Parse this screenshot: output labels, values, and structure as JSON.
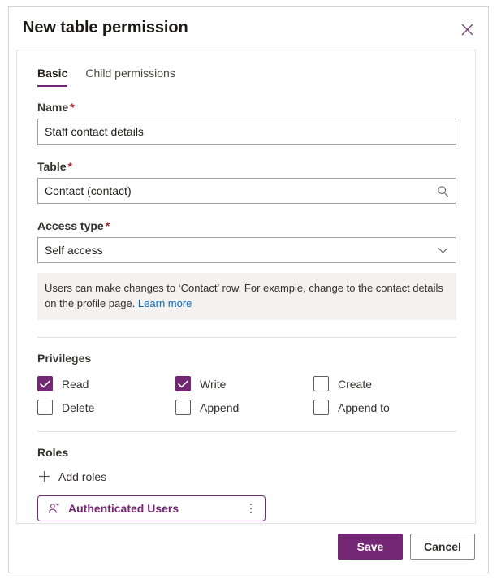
{
  "dialog": {
    "title": "New table permission",
    "close_label": "Close",
    "close_icon": "close-icon"
  },
  "tabs": [
    {
      "label": "Basic",
      "active": true
    },
    {
      "label": "Child permissions",
      "active": false
    }
  ],
  "fields": {
    "name": {
      "label": "Name",
      "required_marker": "*",
      "value": "Staff contact details",
      "placeholder": "Name"
    },
    "table": {
      "label": "Table",
      "required_marker": "*",
      "value": "Contact (contact)",
      "placeholder": "Table",
      "affix_icon": "search-icon"
    },
    "access_type": {
      "label": "Access type",
      "required_marker": "*",
      "value": "Self access",
      "placeholder": "Access type",
      "affix_icon": "chevron-down-icon"
    }
  },
  "info": {
    "text": "Users can make changes to ‘Contact’ row. For example, change to the contact details on the profile page. ",
    "link_label": "Learn more"
  },
  "privileges": {
    "title": "Privileges",
    "items": [
      {
        "label": "Read",
        "checked": true
      },
      {
        "label": "Write",
        "checked": true
      },
      {
        "label": "Create",
        "checked": false
      },
      {
        "label": "Delete",
        "checked": false
      },
      {
        "label": "Append",
        "checked": false
      },
      {
        "label": "Append to",
        "checked": false
      }
    ]
  },
  "roles": {
    "title": "Roles",
    "add_label": "Add roles",
    "add_icon": "plus-icon",
    "chips": [
      {
        "name": "Authenticated Users",
        "icon": "person-icon",
        "menu_icon": "more-vertical-icon"
      }
    ]
  },
  "footer": {
    "save_label": "Save",
    "cancel_label": "Cancel"
  },
  "colors": {
    "accent": "#742774",
    "required": "#a4262c",
    "link": "#0f6cbd",
    "info_bg": "#f3f2f1"
  }
}
